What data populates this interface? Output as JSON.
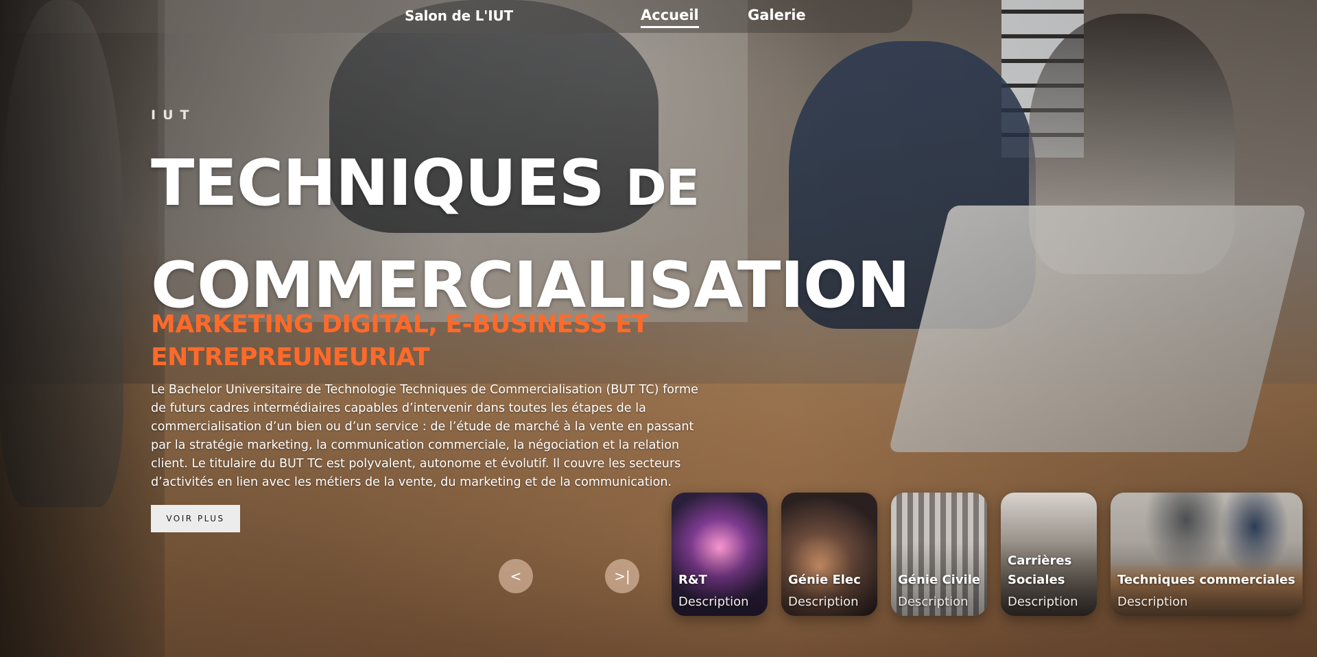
{
  "nav": {
    "brand": "Salon de L'IUT",
    "links": [
      {
        "label": "Accueil",
        "active": true
      },
      {
        "label": "Galerie",
        "active": false
      }
    ]
  },
  "hero": {
    "eyebrow": "IUT",
    "title_main": "TECHNIQUES",
    "title_small": "DE",
    "title_line2": "COMMERCIALISATION",
    "subtitle": "MARKETING DIGITAL, E-BUSINESS ET ENTREPREUNEURIAT",
    "description": "Le Bachelor Universitaire de Technologie Techniques de Commercialisation (BUT TC) forme de futurs cadres intermédiaires capables d’intervenir dans toutes les étapes de la commercialisation d’un bien ou d’un service : de l’étude de marché à la vente en passant par la stratégie marketing, la communication commerciale, la négociation et la relation client. Le titulaire du BUT TC est polyvalent, autonome et évolutif. Il couvre les secteurs d’activités en lien avec les métiers de la vente, du marketing et de la communication.",
    "button_label": "VOIR PLUS"
  },
  "slider": {
    "prev_label": "<",
    "next_label": ">|"
  },
  "cards": [
    {
      "title": "R&T",
      "description": "Description"
    },
    {
      "title": "Génie Elec",
      "description": "Description"
    },
    {
      "title": "Génie Civile",
      "description": "Description"
    },
    {
      "title": "Carrières Sociales",
      "description": "Description"
    },
    {
      "title": "Techniques commerciales",
      "description": "Description"
    }
  ],
  "colors": {
    "accent": "#ff6a2a",
    "button_bg": "#ececec"
  }
}
